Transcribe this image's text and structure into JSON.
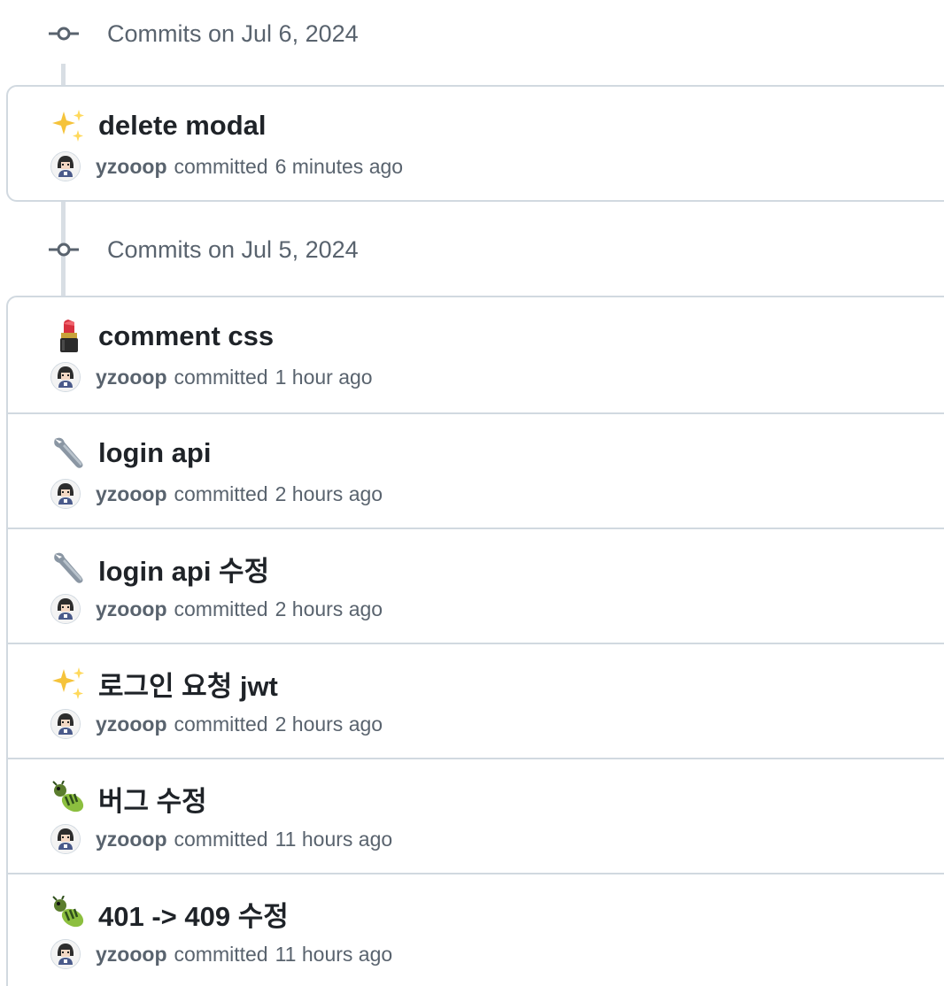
{
  "groups": [
    {
      "date_header": "Commits on Jul 6, 2024",
      "commits": [
        {
          "emoji": "sparkles-icon",
          "title": "delete modal",
          "author": "yzooop",
          "action": "committed",
          "time": "6 minutes ago"
        }
      ]
    },
    {
      "date_header": "Commits on Jul 5, 2024",
      "commits": [
        {
          "emoji": "lipstick-icon",
          "title": "comment css",
          "author": "yzooop",
          "action": "committed",
          "time": "1 hour ago"
        },
        {
          "emoji": "wrench-icon",
          "title": "login api",
          "author": "yzooop",
          "action": "committed",
          "time": "2 hours ago"
        },
        {
          "emoji": "wrench-icon",
          "title": "login api 수정",
          "author": "yzooop",
          "action": "committed",
          "time": "2 hours ago"
        },
        {
          "emoji": "sparkles-icon",
          "title": "로그인 요청 jwt",
          "author": "yzooop",
          "action": "committed",
          "time": "2 hours ago"
        },
        {
          "emoji": "bug-icon",
          "title": "버그 수정",
          "author": "yzooop",
          "action": "committed",
          "time": "11 hours ago"
        },
        {
          "emoji": "bug-icon",
          "title": "401 -> 409 수정",
          "author": "yzooop",
          "action": "committed",
          "time": "11 hours ago"
        }
      ]
    }
  ],
  "colors": {
    "rail": "#d8dee4",
    "border": "#d1d9e0",
    "muted_text": "#59636e",
    "primary_text": "#1f2328"
  }
}
